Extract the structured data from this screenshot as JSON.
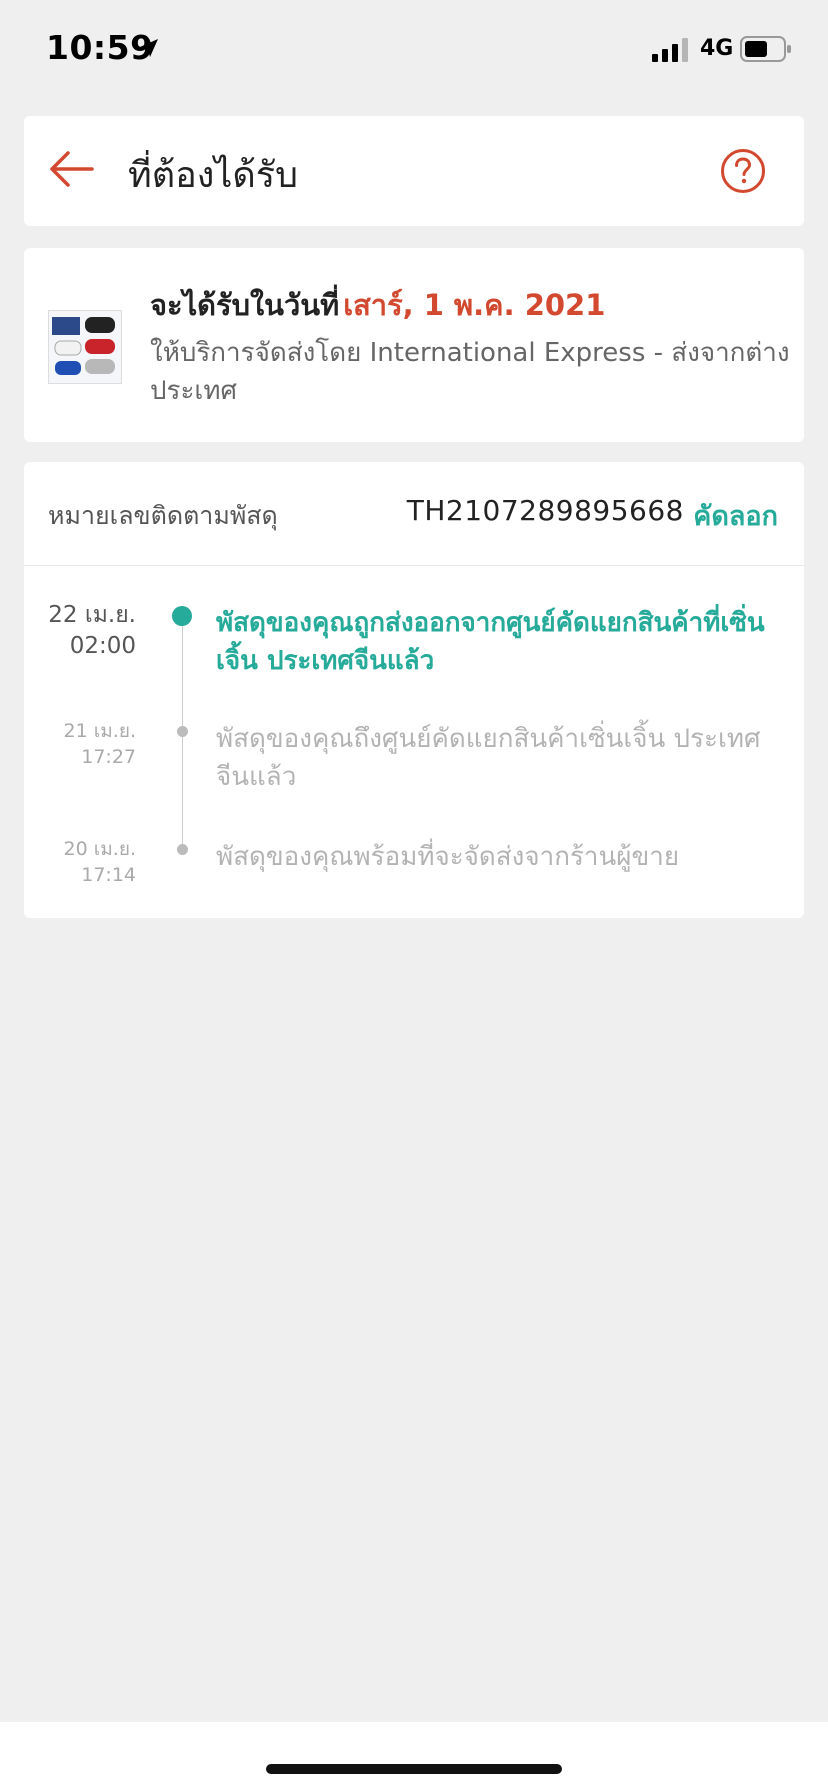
{
  "status_bar": {
    "time": "10:59",
    "network": "4G"
  },
  "header": {
    "title": "ที่ต้องได้รับ",
    "back_icon": "arrow-left-icon",
    "help_icon": "question-circle-icon",
    "accent": "#d2492f"
  },
  "delivery": {
    "eta_label": "จะได้รับในวันที่",
    "eta_date": "เสาร์, 1 พ.ค. 2021",
    "service": "ให้บริการจัดส่งโดย International Express - ส่งจากต่างประเทศ"
  },
  "tracking": {
    "label": "หมายเลขติดตามพัสดุ",
    "number": "TH2107289895668",
    "copy_label": "คัดลอก",
    "events": [
      {
        "date": "22 เม.ย.",
        "time": "02:00",
        "text": "พัสดุของคุณถูกส่งออกจากศูนย์คัดแยกสินค้าที่เซิ่นเจิ้น ประเทศจีนแล้ว"
      },
      {
        "date": "21 เม.ย.",
        "time": "17:27",
        "text": "พัสดุของคุณถึงศูนย์คัดแยกสินค้าเซิ่นเจิ้น ประเทศจีนแล้ว"
      },
      {
        "date": "20 เม.ย.",
        "time": "17:14",
        "text": "พัสดุของคุณพร้อมที่จะจัดส่งจากร้านผู้ขาย"
      }
    ]
  },
  "colors": {
    "accent": "#d2492f",
    "success": "#26aa99",
    "background": "#efefef"
  }
}
